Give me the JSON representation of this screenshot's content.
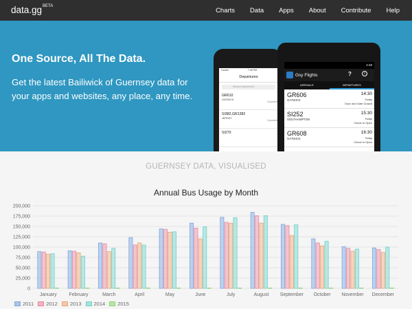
{
  "nav": {
    "brand": "data.gg",
    "brand_badge": "BETA",
    "links": [
      "Charts",
      "Data",
      "Apps",
      "About",
      "Contribute",
      "Help"
    ]
  },
  "hero": {
    "heading": "One Source, All The Data.",
    "text": "Get the latest Bailiwick of Guernsey data for your apps and websites, any place, any time."
  },
  "phone_left": {
    "carrier": "Carrier",
    "time": "7:46 PM",
    "title": "Departures",
    "search_placeholder": "Search departures",
    "rows": [
      {
        "code": "GR610",
        "dest": "GATWICK",
        "status": "Departed"
      },
      {
        "code": "SI382,GR1382",
        "dest": "JERSEY",
        "status": "Departed"
      },
      {
        "code": "SI270",
        "dest": "",
        "status": ""
      }
    ]
  },
  "phone_right": {
    "time": "2:48",
    "app_title": "Gsy Flights",
    "tabs": [
      "ARRIVALS",
      "DEPARTURES"
    ],
    "active_tab": "DEPARTURES",
    "rows": [
      {
        "code": "GR606",
        "dest": "GATWICK",
        "time": "14:30",
        "day": "Today",
        "status": "Door and Gate Closed"
      },
      {
        "code": "SI252",
        "dest": "SOUTHAMPTON",
        "time": "15:30",
        "day": "Today",
        "status": "Check In Open"
      },
      {
        "code": "GR608",
        "dest": "GATWICK",
        "time": "16:30",
        "day": "Today",
        "status": "Check In Open"
      }
    ]
  },
  "section": {
    "title": "GUERNSEY DATA, VISUALISED"
  },
  "chart_data": {
    "type": "bar",
    "title": "Annual Bus Usage by Month",
    "categories": [
      "January",
      "February",
      "March",
      "April",
      "May",
      "June",
      "July",
      "August",
      "September",
      "October",
      "November",
      "December"
    ],
    "ylim": [
      0,
      200000
    ],
    "yticks": [
      "0",
      "25,000",
      "50,000",
      "75,000",
      "100,000",
      "125,000",
      "150,000",
      "175,000",
      "200,000"
    ],
    "grid": true,
    "legend_position": "bottom-left",
    "series": [
      {
        "name": "2011",
        "color": "#a9c4e8",
        "stroke": "#7fa6dc",
        "values": [
          89000,
          91000,
          110000,
          123000,
          144000,
          158000,
          172000,
          184000,
          155000,
          120000,
          101000,
          98000
        ]
      },
      {
        "name": "2012",
        "color": "#f2b3c2",
        "stroke": "#e4899f",
        "values": [
          88000,
          90000,
          108000,
          105000,
          143000,
          146000,
          160000,
          176000,
          152000,
          110000,
          97000,
          94000
        ]
      },
      {
        "name": "2013",
        "color": "#f4c8a8",
        "stroke": "#e7a477",
        "values": [
          83000,
          86000,
          89000,
          110000,
          136000,
          120000,
          158000,
          158000,
          128000,
          103000,
          90000,
          87000
        ]
      },
      {
        "name": "2014",
        "color": "#a6e2dc",
        "stroke": "#6fd0c6",
        "values": [
          84000,
          78000,
          97000,
          105000,
          137000,
          149000,
          171000,
          176000,
          154000,
          114000,
          95000,
          100000
        ]
      },
      {
        "name": "2015",
        "color": "#b8e6a5",
        "stroke": "#8fd376",
        "values": [
          0,
          0,
          0,
          0,
          0,
          0,
          0,
          0,
          0,
          0,
          0,
          0
        ]
      }
    ]
  }
}
